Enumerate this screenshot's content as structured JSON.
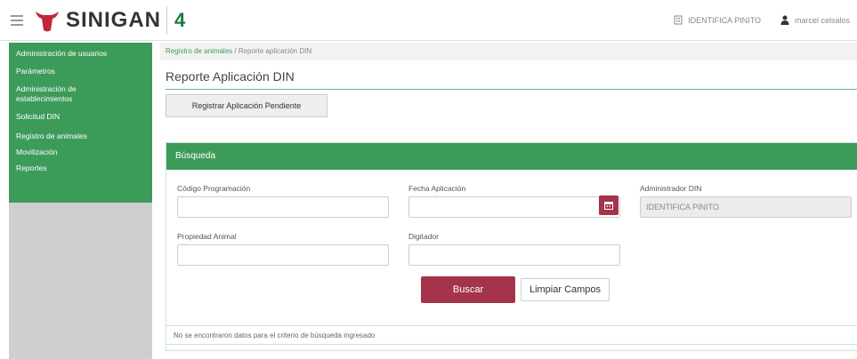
{
  "header": {
    "logo_text": "SINIGAN",
    "logo_number": "4",
    "establishment": "IDENTIFICA PINITO",
    "user": "marcel celsalos"
  },
  "sidebar": {
    "items": [
      {
        "label": "Administración de usuarios"
      },
      {
        "label": "Parámetros"
      },
      {
        "label": "Administración de establecimientos"
      },
      {
        "label": "Solicitud DIN"
      },
      {
        "label": "Registro de animales"
      },
      {
        "label": "Movilización"
      },
      {
        "label": "Reportes"
      }
    ]
  },
  "breadcrumb": {
    "parent": "Registro de animales",
    "separator": " / ",
    "current": "Reporte aplicación DIN"
  },
  "page": {
    "title": "Reporte Aplicación DIN",
    "register_button": "Registrar Aplicación Pendiente"
  },
  "search_panel": {
    "title": "Búsqueda",
    "fields": {
      "codigo_programacion": {
        "label": "Código Programación",
        "value": ""
      },
      "fecha_aplicacion": {
        "label": "Fecha Aplicación",
        "value": ""
      },
      "administrador_din": {
        "label": "Administrador DIN",
        "value": "IDENTIFICA PINITO"
      },
      "propiedad_animal": {
        "label": "Propiedad Animal",
        "value": ""
      },
      "digitador": {
        "label": "Digitador",
        "value": ""
      }
    },
    "search_button": "Buscar",
    "clear_button": "Limpiar Campos"
  },
  "results": {
    "message": "No se encontraron datos para el criterio de búsqueda ingresado"
  },
  "colors": {
    "brand_green": "#3d9b5a",
    "accent_red": "#a5334a",
    "sidebar_gray": "#cfcfcf"
  },
  "icons": {
    "menu": "hamburger-icon",
    "establishment": "building-icon",
    "user": "user-icon",
    "calendar": "calendar-icon"
  }
}
